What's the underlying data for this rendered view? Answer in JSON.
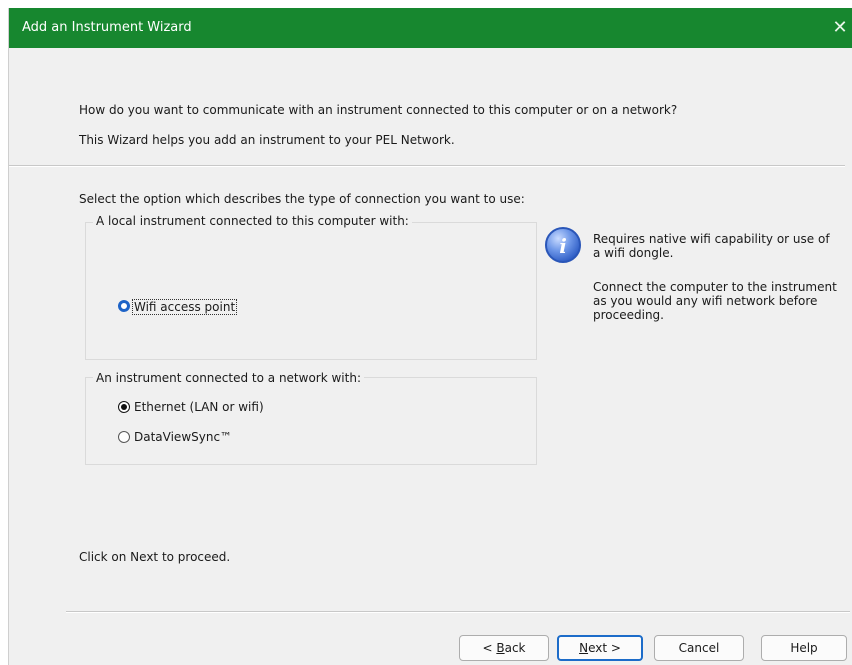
{
  "window": {
    "title": "Add an Instrument Wizard",
    "close_glyph": "✕"
  },
  "header": {
    "question": "How do you want to communicate with an instrument connected to this computer or on a network?",
    "description": "This Wizard helps you add an instrument to your PEL Network."
  },
  "body": {
    "prompt": "Select the option which describes the type of connection you want to use:",
    "local_group": {
      "legend": "A local instrument connected to this computer with:",
      "options": [
        {
          "label": "Wifi access point",
          "state": "focused"
        }
      ]
    },
    "network_group": {
      "legend": "An instrument connected to a network with:",
      "options": [
        {
          "label": "Ethernet (LAN or wifi)",
          "state": "selected"
        },
        {
          "label": "DataViewSync™",
          "state": "unselected"
        }
      ]
    },
    "info": {
      "icon": "info-icon",
      "line1": "Requires native wifi capability or use of",
      "line2": "a wifi dongle.",
      "line3": "Connect the computer to the instrument",
      "line4": "as you would any wifi network before",
      "line5": "proceeding."
    },
    "footer_hint": "Click on Next to proceed."
  },
  "buttons": {
    "back_prefix": "< ",
    "back_mnemonic": "B",
    "back_rest": "ack",
    "next_mnemonic": "N",
    "next_rest": "ext >",
    "cancel": "Cancel",
    "help": "Help"
  },
  "colors": {
    "titlebar": "#17872f",
    "focus": "#1d63c7",
    "dialog_bg": "#f0f0f0"
  }
}
